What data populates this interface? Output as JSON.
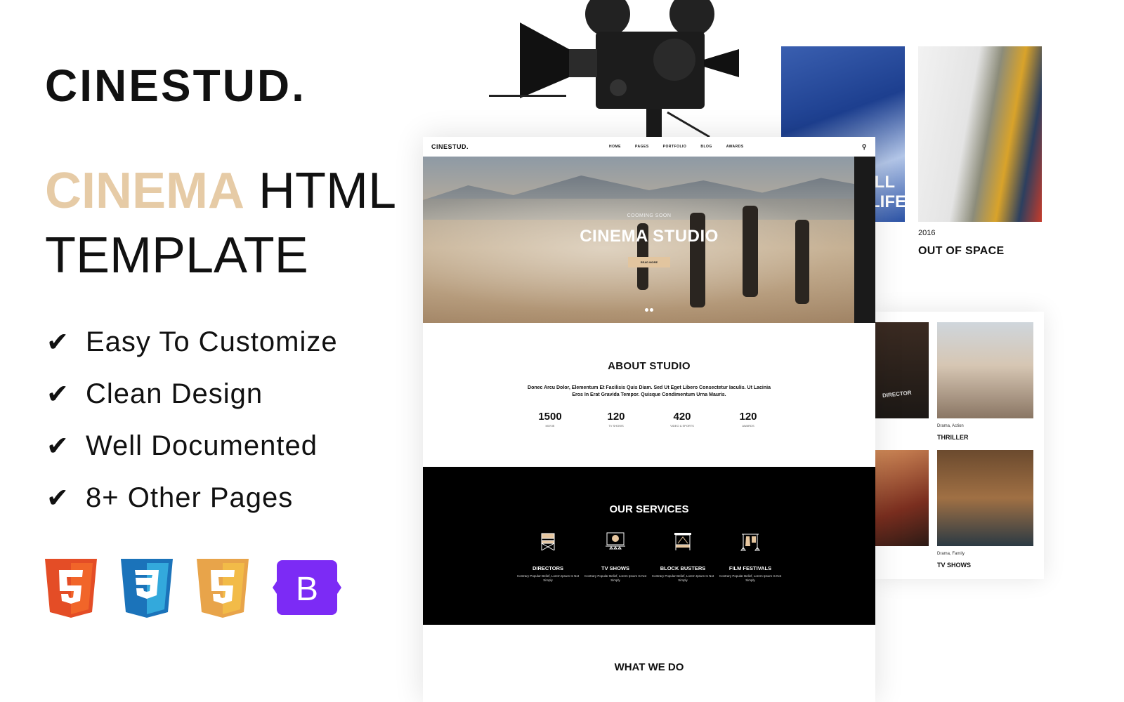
{
  "brand": {
    "name": "CINESTUD."
  },
  "headline": {
    "accent": "CINEMA",
    "rest_line1": " HTML",
    "line2": "TEMPLATE"
  },
  "features": [
    {
      "icon": "check-icon",
      "label": "Easy To Customize"
    },
    {
      "icon": "check-icon",
      "label": "Clean Design"
    },
    {
      "icon": "check-icon",
      "label": "Well Documented"
    },
    {
      "icon": "check-icon",
      "label": "8+ Other Pages"
    }
  ],
  "badges": [
    {
      "name": "html5-logo",
      "color": "#e44d26",
      "glyph": "5"
    },
    {
      "name": "css3-logo",
      "color": "#1b73ba",
      "glyph": "3"
    },
    {
      "name": "javascript-logo",
      "color": "#f0a830",
      "glyph": "5"
    },
    {
      "name": "bootstrap-logo",
      "color": "#7c2bf5",
      "glyph": "B"
    }
  ],
  "mockup": {
    "nav": {
      "logo": "CINESTUD.",
      "links": [
        "HOME",
        "PAGES",
        "PORTFOLIO",
        "BLOG",
        "AWARDS"
      ]
    },
    "hero": {
      "kicker": "COOMING SOON",
      "title": "CINEMA STUDIO",
      "button": "READ MORE"
    },
    "about": {
      "title": "ABOUT STUDIO",
      "text": "Donec Arcu Dolor, Elementum Et Facilisis Quis Diam. Sed Ut Eget Libero Consectetur Iaculis. Ut Lacinia Eros In Erat Gravida Tempor. Quisque Condimentum Urna Mauris.",
      "stats": [
        {
          "value": "1500",
          "label": "MOVIE"
        },
        {
          "value": "120",
          "label": "TV SHOWS"
        },
        {
          "value": "420",
          "label": "VIDEO & SPORTS"
        },
        {
          "value": "120",
          "label": "AWARDS"
        }
      ]
    },
    "services": {
      "title": "OUR SERVICES",
      "items": [
        {
          "title": "DIRECTORS",
          "text": "Contrary Popular Belief, Lorem Ipsum Is Not Simply"
        },
        {
          "title": "TV SHOWS",
          "text": "Contrary Popular Belief, Lorem Ipsum Is Not Simply"
        },
        {
          "title": "BLOCK BUSTERS",
          "text": "Contrary Popular Belief, Lorem Ipsum Is Not Simply"
        },
        {
          "title": "FILM FESTIVALS",
          "text": "Contrary Popular Belief, Lorem Ipsum Is Not Simply"
        }
      ]
    },
    "what": {
      "title": "WHAT WE DO"
    }
  },
  "portfolio": {
    "year": "2016",
    "title": "OUT OF SPACE",
    "poster_text": "ILL LIFE"
  },
  "gallery": [
    {
      "genre": "Drama, Action",
      "title": "THRILLER",
      "badge": "DIRECTOR"
    },
    {
      "genre": "Drama, Family",
      "title": "TV SHOWS"
    }
  ]
}
